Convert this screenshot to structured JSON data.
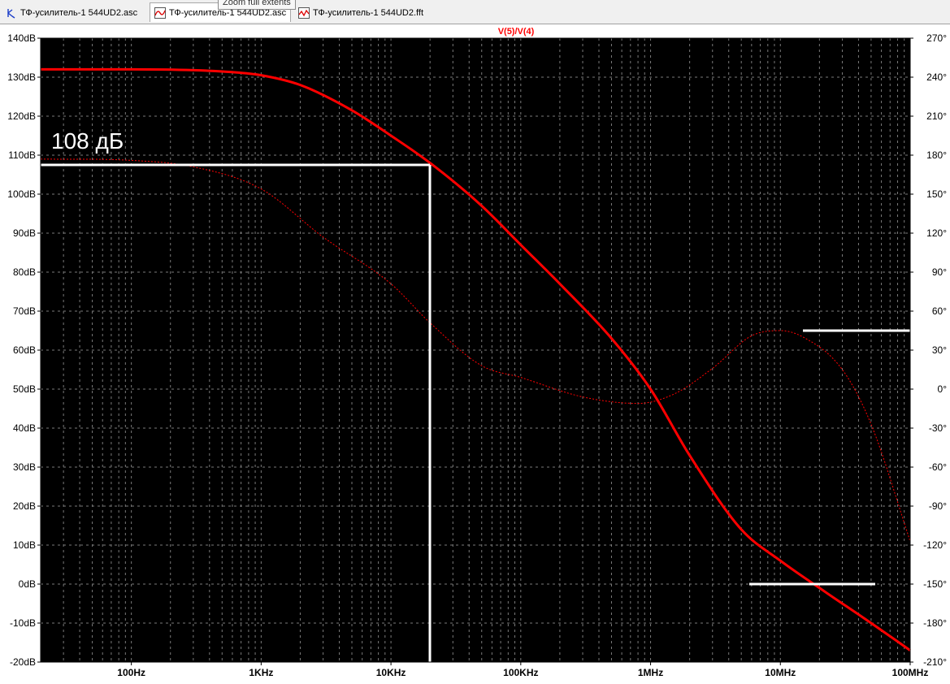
{
  "tabs": [
    {
      "label": "ТФ-усилитель-1 544UD2.asc",
      "icon": "schematic-icon",
      "active": false
    },
    {
      "label": "ТФ-усилитель-1 544UD2.asc",
      "icon": "waveform-icon",
      "active": true
    },
    {
      "label": "ТФ-усилитель-1 544UD2.fft",
      "icon": "fft-icon",
      "active": false
    }
  ],
  "tooltip": "Zoom full extents",
  "colors": {
    "background": "#000000",
    "trace": "#ff0000",
    "title": "#ff0000",
    "grid": "#7a7a7a",
    "axis_text": "#000000",
    "annotation": "#ffffff"
  },
  "chart_data": {
    "type": "line",
    "title": "V(5)/V(4)",
    "x_scale": "log",
    "xlim": [
      20,
      100000000
    ],
    "x_ticks": [
      {
        "value": 100,
        "label": "100Hz"
      },
      {
        "value": 1000,
        "label": "1KHz"
      },
      {
        "value": 10000,
        "label": "10KHz"
      },
      {
        "value": 100000,
        "label": "100KHz"
      },
      {
        "value": 1000000,
        "label": "1MHz"
      },
      {
        "value": 10000000,
        "label": "10MHz"
      },
      {
        "value": 100000000,
        "label": "100MHz"
      }
    ],
    "ylim_left": [
      -20,
      140
    ],
    "y_left_ticks": [
      "140dB",
      "130dB",
      "120dB",
      "110dB",
      "100dB",
      "90dB",
      "80dB",
      "70dB",
      "60dB",
      "50dB",
      "40dB",
      "30dB",
      "20dB",
      "10dB",
      "0dB",
      "-10dB",
      "-20dB"
    ],
    "ylim_right": [
      -210,
      270
    ],
    "y_right_ticks": [
      "270°",
      "240°",
      "210°",
      "180°",
      "150°",
      "120°",
      "90°",
      "60°",
      "30°",
      "0°",
      "-30°",
      "-60°",
      "-90°",
      "-120°",
      "-150°",
      "-180°",
      "-210°"
    ],
    "grid": true,
    "series": [
      {
        "style": "solid-thick",
        "axis": "left",
        "x": [
          20,
          100,
          300,
          600,
          1000,
          2000,
          5000,
          10000,
          20000,
          50000,
          100000,
          200000,
          500000,
          1000000,
          2000000,
          5000000,
          10000000,
          20000000,
          50000000,
          100000000
        ],
        "y": [
          132,
          132,
          131.8,
          131.3,
          130.5,
          128,
          121.5,
          115,
          108,
          97,
          87,
          77,
          63,
          50,
          33,
          14,
          6,
          -1,
          -10,
          -17
        ]
      },
      {
        "style": "dotted-thin",
        "axis": "right",
        "x": [
          20,
          100,
          300,
          1000,
          3000,
          10000,
          20000,
          50000,
          100000,
          300000,
          800000,
          1500000,
          3000000,
          6000000,
          10000000,
          15000000,
          30000000,
          50000000,
          100000000
        ],
        "y": [
          177,
          176,
          171,
          154,
          117,
          81,
          51,
          18,
          9,
          -6,
          -11,
          -4,
          16,
          41,
          45,
          40,
          15,
          -27,
          -117
        ]
      }
    ],
    "annotations": [
      {
        "text": "108 дБ"
      }
    ]
  }
}
